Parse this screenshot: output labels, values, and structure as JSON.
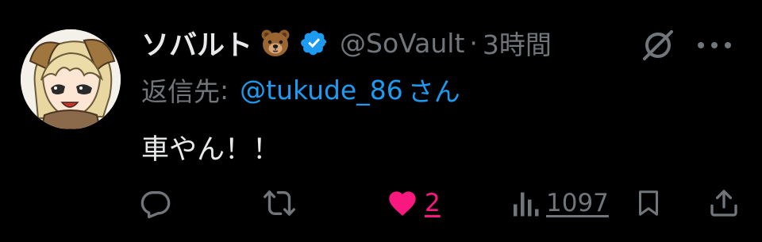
{
  "post": {
    "display_name": "ソバルト",
    "name_emoji": "bear-face-emoji",
    "handle": "@SoVault",
    "separator": "·",
    "time": "3時間",
    "reply_label": "返信先",
    "reply_colon": ":",
    "reply_to": "@tukude_86",
    "reply_suffix": "さん",
    "text": "車やん！！"
  },
  "actions": {
    "likes": "2",
    "views": "1097"
  },
  "colors": {
    "background": "#000000",
    "text": "#e7e9ea",
    "muted": "#71767b",
    "link": "#1d9bf0",
    "like": "#f91880",
    "verified": "#1d9bf0"
  },
  "icons": [
    "reply-icon",
    "retweet-icon",
    "heart-icon",
    "views-icon",
    "bookmark-icon",
    "share-icon",
    "grok-icon",
    "more-icon",
    "verified-badge-icon"
  ]
}
